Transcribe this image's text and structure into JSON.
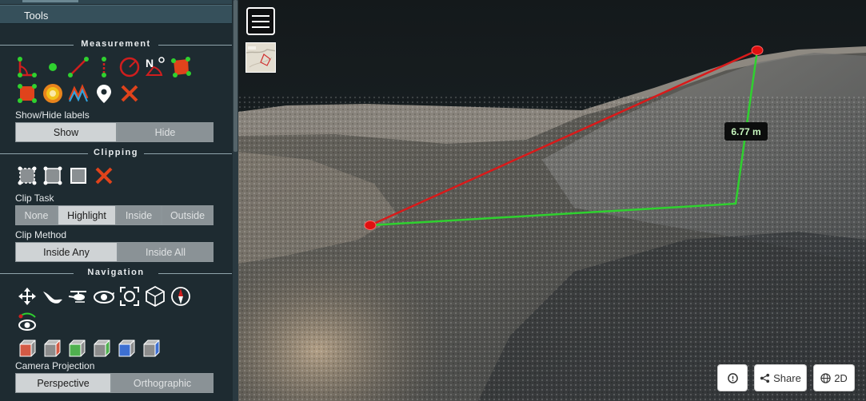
{
  "sidebar": {
    "tools_header": "Tools",
    "measurement": {
      "title": "Measurement",
      "tool_icons_row1": [
        "angle-icon",
        "point-icon",
        "distance-icon",
        "height-icon",
        "circle-icon",
        "azimuth-icon",
        "area-icon"
      ],
      "tool_icons_row2": [
        "volume-icon",
        "sphere-volume-icon",
        "profile-icon",
        "annotation-icon",
        "remove-measurements-icon"
      ],
      "azimuth_letter": "N",
      "labels_caption": "Show/Hide labels",
      "show_label": "Show",
      "hide_label": "Hide"
    },
    "clipping": {
      "title": "Clipping",
      "tool_icons": [
        "clip-volume-icon",
        "clip-polygon-icon",
        "clip-screen-box-icon",
        "remove-clipping-icon"
      ],
      "task_caption": "Clip Task",
      "tasks": [
        "None",
        "Highlight",
        "Inside",
        "Outside"
      ],
      "active_task": "Highlight",
      "method_caption": "Clip Method",
      "methods": [
        "Inside Any",
        "Inside All"
      ],
      "active_method": "Inside Any"
    },
    "navigation": {
      "title": "Navigation",
      "nav_icons": [
        "earth-controls-icon",
        "fly-controls-icon",
        "helicopter-controls-icon",
        "orbit-controls-icon",
        "full-extent-icon",
        "navigation-cube-icon",
        "compass-icon",
        "eye-dome-icon"
      ],
      "view_icons": [
        "left-view-icon",
        "front-view-icon",
        "top-view-icon",
        "back-view-icon",
        "right-view-icon",
        "bottom-view-icon"
      ],
      "projection_caption": "Camera Projection",
      "projections": [
        "Perspective",
        "Orthographic"
      ],
      "active_projection": "Perspective"
    }
  },
  "viewer": {
    "measurement_value": "6.77 m",
    "share_label": "Share",
    "mode_label": "2D",
    "colors": {
      "measure_red": "#d91a1a",
      "measure_green": "#2fd12f",
      "sky": "#1a2428",
      "terrain": "#5b5e5d"
    }
  }
}
